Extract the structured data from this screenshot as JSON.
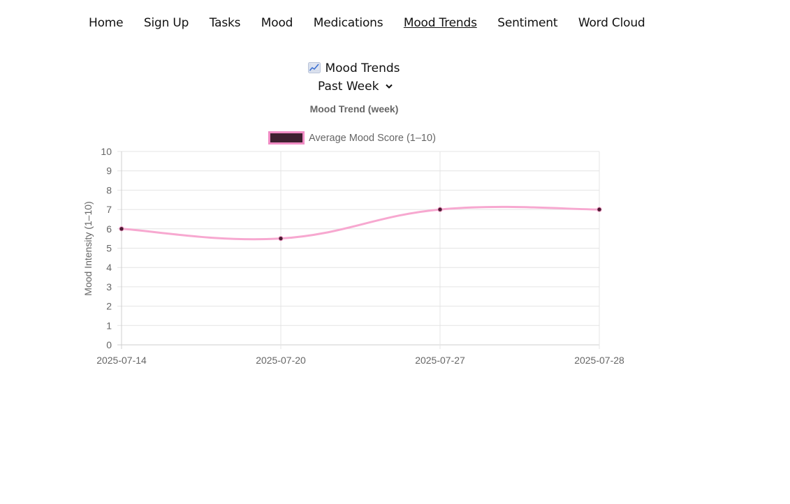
{
  "nav": {
    "items": [
      {
        "label": "Home",
        "active": false
      },
      {
        "label": "Sign Up",
        "active": false
      },
      {
        "label": "Tasks",
        "active": false
      },
      {
        "label": "Mood",
        "active": false
      },
      {
        "label": "Medications",
        "active": false
      },
      {
        "label": "Mood Trends",
        "active": true
      },
      {
        "label": "Sentiment",
        "active": false
      },
      {
        "label": "Word Cloud",
        "active": false
      }
    ]
  },
  "page": {
    "title": "Mood Trends",
    "title_icon": "chart-increasing-icon",
    "range_select": {
      "value": "Past Week"
    }
  },
  "colors": {
    "line": "#f7a8d0",
    "point": "#4a1a30",
    "legend_fill": "#3e2030",
    "legend_border": "#f08cc4",
    "grid": "#e4e4e4",
    "axis_text": "#666666"
  },
  "chart_data": {
    "type": "line",
    "title": "Mood Trend (week)",
    "ylabel": "Mood Intensity (1–10)",
    "xlabel": "",
    "categories": [
      "2025-07-14",
      "2025-07-20",
      "2025-07-27",
      "2025-07-28"
    ],
    "series": [
      {
        "name": "Average Mood Score (1–10)",
        "values": [
          6,
          5.5,
          7,
          7
        ]
      }
    ],
    "ylim": [
      0,
      10
    ],
    "yticks": [
      0,
      1,
      2,
      3,
      4,
      5,
      6,
      7,
      8,
      9,
      10
    ],
    "grid": true,
    "legend_position": "top"
  }
}
